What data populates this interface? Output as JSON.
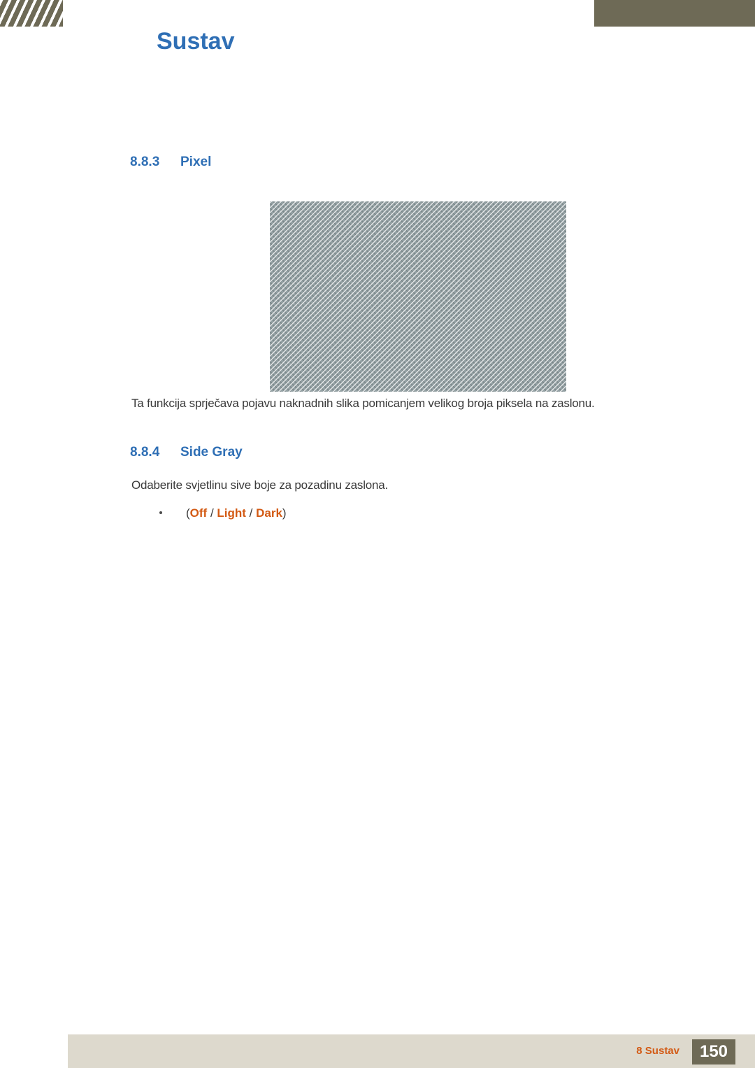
{
  "header": {
    "chapter_number": "8",
    "title": "Sustav"
  },
  "sections": [
    {
      "number": "8.8.3",
      "title": "Pixel",
      "description": "Ta funkcija sprječava pojavu naknadnih slika pomicanjem velikog broja piksela na zaslonu."
    },
    {
      "number": "8.8.4",
      "title": "Side Gray",
      "description": "Odaberite svjetlinu sive boje za pozadinu zaslona.",
      "options": {
        "open_paren": "(",
        "values": [
          "Off",
          "Light",
          "Dark"
        ],
        "separator": "/",
        "close_paren": ")"
      }
    }
  ],
  "figure": {
    "alt": "pixel-shift-pattern"
  },
  "footer": {
    "chapter_label": "8 Sustav",
    "page_number": "150"
  },
  "colors": {
    "accent_blue": "#2f6fb5",
    "accent_orange": "#d35a14",
    "header_olive": "#6e6a56",
    "footer_beige": "#ddd9cd"
  }
}
